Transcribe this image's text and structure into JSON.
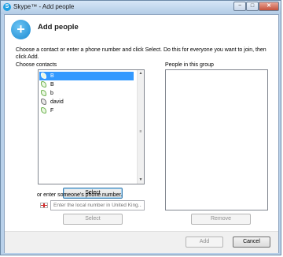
{
  "window": {
    "title": "Skype™ - Add people",
    "app_icon": "S",
    "minimize": "−",
    "maximize": "□",
    "close": "✕"
  },
  "header": {
    "title": "Add people",
    "icon": "+"
  },
  "instructions": "Choose a contact or enter a phone number and click Select. Do this for everyone you want to join, then click Add.",
  "contacts": {
    "label": "Choose contacts",
    "items": [
      {
        "name": "B",
        "icon": "green",
        "selected": true
      },
      {
        "name": "B",
        "icon": "green",
        "selected": false
      },
      {
        "name": "b",
        "icon": "green",
        "selected": false
      },
      {
        "name": "david",
        "icon": "grey",
        "selected": false
      },
      {
        "name": "F",
        "icon": "green",
        "selected": false
      }
    ],
    "select_button": "Select"
  },
  "phone": {
    "label": "or enter someone's phone number.",
    "placeholder": "Enter the local number in United King...",
    "value": "",
    "select_button": "Select"
  },
  "group": {
    "label": "People in this group",
    "remove_button": "Remove"
  },
  "footer": {
    "add_button": "Add",
    "cancel_button": "Cancel"
  },
  "colors": {
    "selection": "#3399ff",
    "title_bar": "#b9d1ea",
    "online_icon": "#6ab04c"
  }
}
